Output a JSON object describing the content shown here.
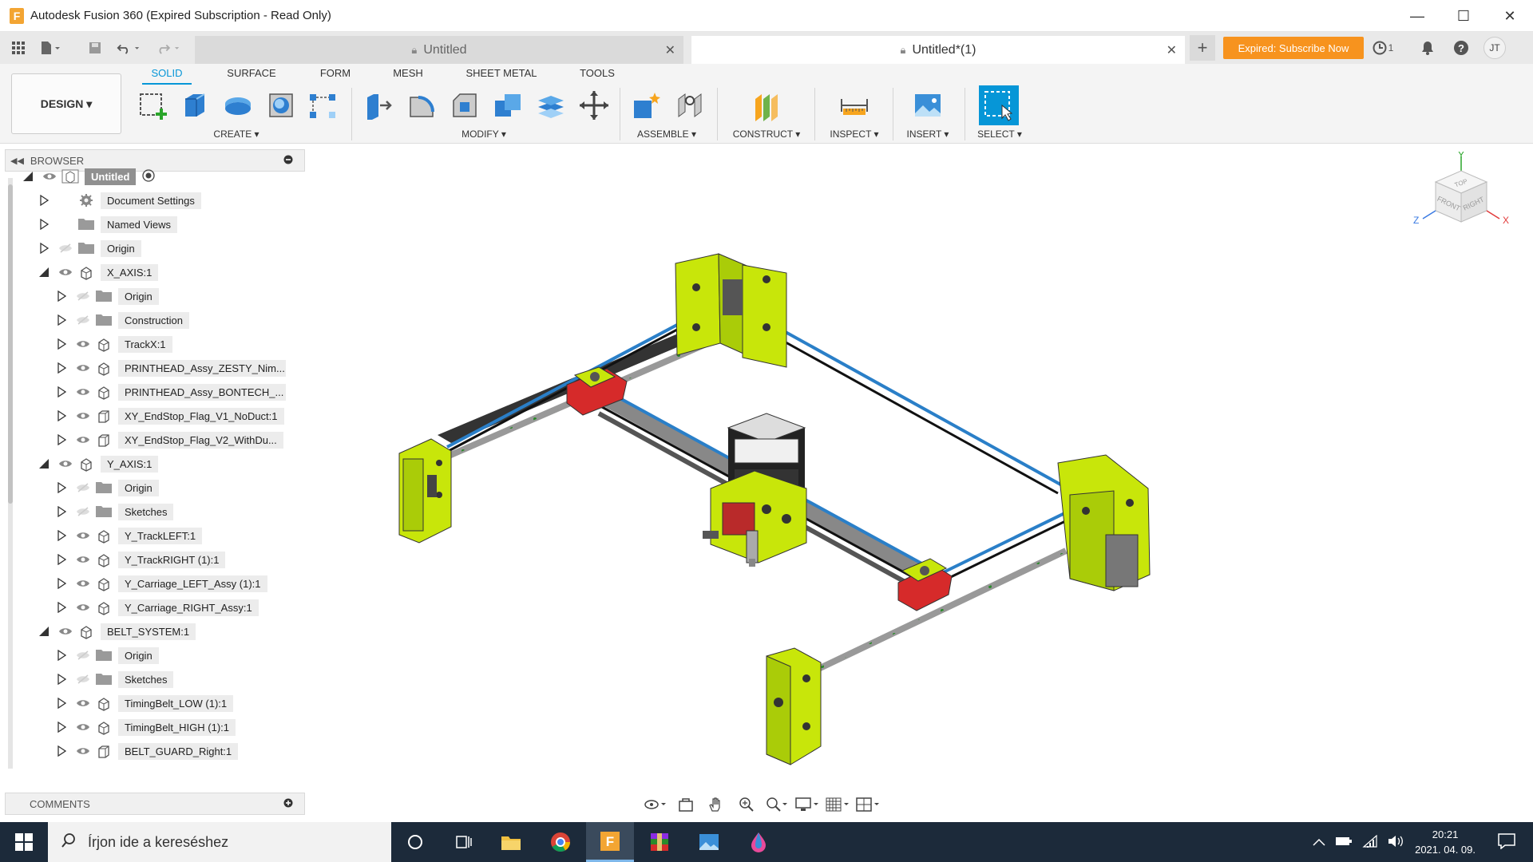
{
  "window": {
    "app_letter": "F",
    "title": "Autodesk Fusion 360 (Expired Subscription - Read Only)",
    "minimize": "—",
    "maximize": "☐",
    "close": "✕"
  },
  "tabs": {
    "inactive_label": "Untitled",
    "active_label": "Untitled*(1)",
    "new_tab": "+",
    "close_glyph": "✕"
  },
  "header_right": {
    "subscribe_label": "Expired: Subscribe Now",
    "jobs_count": "1",
    "avatar_initials": "JT"
  },
  "toolbar": {
    "design_label": "DESIGN ▾",
    "workspace_tabs": [
      "SOLID",
      "SURFACE",
      "FORM",
      "MESH",
      "SHEET METAL",
      "TOOLS"
    ],
    "groups": {
      "create": "CREATE ▾",
      "modify": "MODIFY ▾",
      "assemble": "ASSEMBLE ▾",
      "construct": "CONSTRUCT ▾",
      "inspect": "INSPECT ▾",
      "insert": "INSERT ▾",
      "select": "SELECT ▾"
    }
  },
  "browser": {
    "title": "BROWSER",
    "items": [
      {
        "label": "Untitled",
        "depth": 0,
        "expanded": true,
        "kind": "root",
        "visible": true
      },
      {
        "label": "Document Settings",
        "depth": 1,
        "expanded": false,
        "kind": "gear",
        "visible": null
      },
      {
        "label": "Named Views",
        "depth": 1,
        "expanded": false,
        "kind": "folder",
        "visible": null
      },
      {
        "label": "Origin",
        "depth": 1,
        "expanded": false,
        "kind": "folder",
        "visible": false
      },
      {
        "label": "X_AXIS:1",
        "depth": 1,
        "expanded": true,
        "kind": "component",
        "visible": true
      },
      {
        "label": "Origin",
        "depth": 2,
        "expanded": false,
        "kind": "folder",
        "visible": false
      },
      {
        "label": "Construction",
        "depth": 2,
        "expanded": false,
        "kind": "folder",
        "visible": false
      },
      {
        "label": "TrackX:1",
        "depth": 2,
        "expanded": false,
        "kind": "component",
        "visible": true
      },
      {
        "label": "PRINTHEAD_Assy_ZESTY_Nim...",
        "depth": 2,
        "expanded": false,
        "kind": "component",
        "visible": true
      },
      {
        "label": "PRINTHEAD_Assy_BONTECH_...",
        "depth": 2,
        "expanded": false,
        "kind": "component",
        "visible": true
      },
      {
        "label": "XY_EndStop_Flag_V1_NoDuct:1",
        "depth": 2,
        "expanded": false,
        "kind": "body",
        "visible": true
      },
      {
        "label": "XY_EndStop_Flag_V2_WithDu...",
        "depth": 2,
        "expanded": false,
        "kind": "body",
        "visible": true
      },
      {
        "label": "Y_AXIS:1",
        "depth": 1,
        "expanded": true,
        "kind": "component",
        "visible": true
      },
      {
        "label": "Origin",
        "depth": 2,
        "expanded": false,
        "kind": "folder",
        "visible": false
      },
      {
        "label": "Sketches",
        "depth": 2,
        "expanded": false,
        "kind": "folder",
        "visible": false
      },
      {
        "label": "Y_TrackLEFT:1",
        "depth": 2,
        "expanded": false,
        "kind": "component",
        "visible": true
      },
      {
        "label": "Y_TrackRIGHT (1):1",
        "depth": 2,
        "expanded": false,
        "kind": "component",
        "visible": true
      },
      {
        "label": "Y_Carriage_LEFT_Assy (1):1",
        "depth": 2,
        "expanded": false,
        "kind": "component",
        "visible": true
      },
      {
        "label": "Y_Carriage_RIGHT_Assy:1",
        "depth": 2,
        "expanded": false,
        "kind": "component",
        "visible": true
      },
      {
        "label": "BELT_SYSTEM:1",
        "depth": 1,
        "expanded": true,
        "kind": "component",
        "visible": true
      },
      {
        "label": "Origin",
        "depth": 2,
        "expanded": false,
        "kind": "folder",
        "visible": false
      },
      {
        "label": "Sketches",
        "depth": 2,
        "expanded": false,
        "kind": "folder",
        "visible": false
      },
      {
        "label": "TimingBelt_LOW (1):1",
        "depth": 2,
        "expanded": false,
        "kind": "component",
        "visible": true
      },
      {
        "label": "TimingBelt_HIGH (1):1",
        "depth": 2,
        "expanded": false,
        "kind": "component",
        "visible": true
      },
      {
        "label": "BELT_GUARD_Right:1",
        "depth": 2,
        "expanded": false,
        "kind": "body",
        "visible": true
      }
    ]
  },
  "comments": {
    "title": "COMMENTS"
  },
  "viewcube": {
    "top": "TOP",
    "front": "FRONT",
    "right": "RIGHT",
    "axis_x": "X",
    "axis_y": "Y",
    "axis_z": "Z"
  },
  "taskbar": {
    "search_placeholder": "Írjon ide a kereséshez",
    "time": "20:21",
    "date": "2021. 04. 09."
  },
  "colors": {
    "accent": "#0696d7",
    "subscribe": "#f7931e",
    "part_green": "#c8e60a",
    "taskbar": "#1c2a3a"
  }
}
